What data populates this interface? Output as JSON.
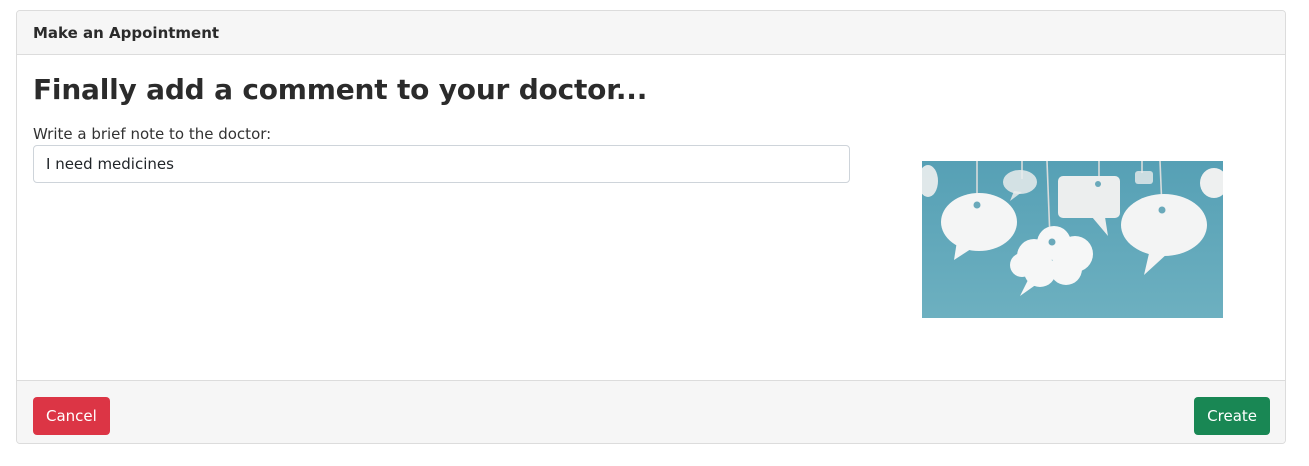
{
  "card": {
    "header_title": "Make an Appointment"
  },
  "form": {
    "heading": "Finally add a comment to your doctor...",
    "note_label": "Write a brief note to the doctor:",
    "note_value": "I need medicines"
  },
  "illustration": {
    "icon": "speech-bubbles-illustration",
    "background_color": "#5fa3b6"
  },
  "footer": {
    "cancel_label": "Cancel",
    "create_label": "Create"
  },
  "colors": {
    "cancel": "#dc3545",
    "create": "#198754",
    "header_bg": "#f6f6f6"
  }
}
